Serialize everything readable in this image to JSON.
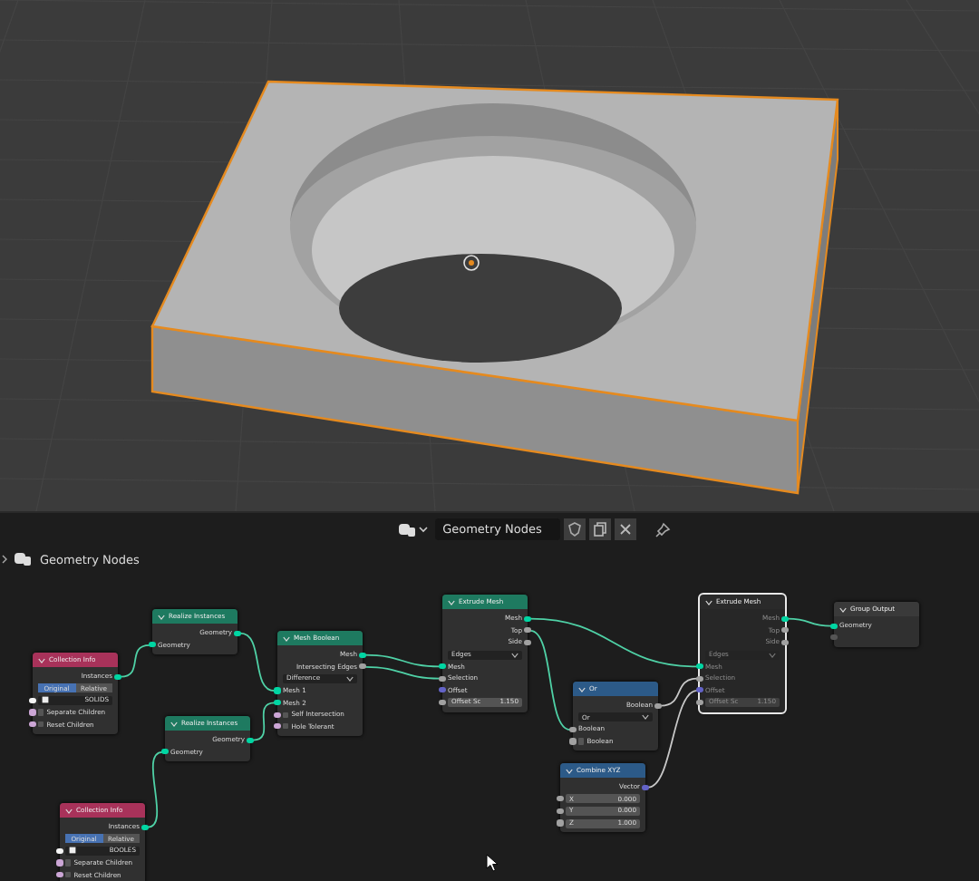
{
  "header": {
    "node_tree_name": "Geometry Nodes"
  },
  "breadcrumb": {
    "label": "Geometry Nodes"
  },
  "nodes": [
    {
      "title": "Collection Info",
      "color": "#a8325a",
      "selected": false,
      "muted": false,
      "rows": [
        {
          "kind": "output",
          "label": "Instances",
          "socket": {
            "color": "#00d6a3"
          }
        },
        {
          "kind": "toggle",
          "options": [
            {
              "label": "Original",
              "selected": true
            },
            {
              "label": "Relative",
              "selected": false
            }
          ]
        },
        {
          "kind": "field",
          "label": "SOLIDS",
          "socket": {
            "color": "#f5f5f5"
          }
        },
        {
          "kind": "checkbox",
          "label": "Separate Children",
          "checked": false,
          "socket": {
            "color": "#cca6d6"
          }
        },
        {
          "kind": "checkbox",
          "label": "Reset Children",
          "checked": false,
          "socket": {
            "color": "#cca6d6"
          }
        }
      ]
    },
    {
      "title": "Realize Instances",
      "color": "#1e7a60",
      "selected": false,
      "muted": false,
      "rows": [
        {
          "kind": "output",
          "label": "Geometry",
          "socket": {
            "color": "#00d6a3"
          }
        },
        {
          "kind": "input",
          "label": "Geometry",
          "socket": {
            "color": "#00d6a3"
          }
        }
      ]
    },
    {
      "title": "Realize Instances",
      "color": "#1e7a60",
      "selected": false,
      "muted": false,
      "rows": [
        {
          "kind": "output",
          "label": "Geometry",
          "socket": {
            "color": "#00d6a3"
          }
        },
        {
          "kind": "input",
          "label": "Geometry",
          "socket": {
            "color": "#00d6a3"
          }
        }
      ]
    },
    {
      "title": "Mesh Boolean",
      "color": "#1e7a60",
      "selected": false,
      "muted": false,
      "rows": [
        {
          "kind": "output",
          "label": "Mesh",
          "socket": {
            "color": "#00d6a3"
          }
        },
        {
          "kind": "output",
          "label": "Intersecting Edges",
          "socket": {
            "color": "#a1a1a1"
          }
        },
        {
          "kind": "enum",
          "label": "Difference"
        },
        {
          "kind": "input",
          "label": "Mesh 1",
          "socket": {
            "color": "#00d6a3"
          }
        },
        {
          "kind": "input",
          "label": "Mesh 2",
          "socket": {
            "color": "#00d6a3"
          }
        },
        {
          "kind": "checkbox",
          "label": "Self Intersection",
          "checked": false,
          "socket": {
            "color": "#cca6d6"
          }
        },
        {
          "kind": "checkbox",
          "label": "Hole Tolerant",
          "checked": false,
          "socket": {
            "color": "#cca6d6"
          }
        }
      ]
    },
    {
      "title": "Extrude Mesh",
      "color": "#1e7a60",
      "selected": false,
      "muted": false,
      "rows": [
        {
          "kind": "output",
          "label": "Mesh",
          "socket": {
            "color": "#00d6a3"
          }
        },
        {
          "kind": "output",
          "label": "Top",
          "socket": {
            "color": "#a1a1a1"
          }
        },
        {
          "kind": "output",
          "label": "Side",
          "socket": {
            "color": "#a1a1a1"
          }
        },
        {
          "kind": "enum",
          "label": "Edges"
        },
        {
          "kind": "input",
          "label": "Mesh",
          "socket": {
            "color": "#00d6a3"
          }
        },
        {
          "kind": "input",
          "label": "Selection",
          "socket": {
            "color": "#a1a1a1"
          }
        },
        {
          "kind": "input",
          "label": "Offset",
          "socket": {
            "color": "#6363c7"
          }
        },
        {
          "kind": "value",
          "label": "Offset Sc",
          "value": "1.150",
          "socket": {
            "color": "#a1a1a1"
          }
        }
      ]
    },
    {
      "title": "Or",
      "color": "#2c5a88",
      "selected": false,
      "muted": false,
      "rows": [
        {
          "kind": "output",
          "label": "Boolean",
          "socket": {
            "color": "#a1a1a1"
          }
        },
        {
          "kind": "enum",
          "label": "Or"
        },
        {
          "kind": "input",
          "label": "Boolean",
          "socket": {
            "color": "#a1a1a1"
          }
        },
        {
          "kind": "checkbox",
          "label": "Boolean",
          "checked": false,
          "socket": {
            "color": "#a1a1a1"
          }
        }
      ]
    },
    {
      "title": "Combine XYZ",
      "color": "#2c5a88",
      "selected": false,
      "muted": false,
      "rows": [
        {
          "kind": "output",
          "label": "Vector",
          "socket": {
            "color": "#6363c7"
          }
        },
        {
          "kind": "value",
          "label": "X",
          "value": "0.000",
          "socket": {
            "color": "#a1a1a1"
          }
        },
        {
          "kind": "value",
          "label": "Y",
          "value": "0.000",
          "socket": {
            "color": "#a1a1a1"
          }
        },
        {
          "kind": "value",
          "label": "Z",
          "value": "1.000",
          "socket": {
            "color": "#a1a1a1"
          }
        }
      ]
    },
    {
      "title": "Extrude Mesh",
      "color": "#2a2a2a",
      "selected": true,
      "muted": true,
      "rows": [
        {
          "kind": "output",
          "label": "Mesh",
          "socket": {
            "color": "#00d6a3"
          }
        },
        {
          "kind": "output",
          "label": "Top",
          "socket": {
            "color": "#a1a1a1"
          }
        },
        {
          "kind": "output",
          "label": "Side",
          "socket": {
            "color": "#a1a1a1"
          }
        },
        {
          "kind": "enum",
          "label": "Edges"
        },
        {
          "kind": "input",
          "label": "Mesh",
          "socket": {
            "color": "#00d6a3"
          }
        },
        {
          "kind": "input",
          "label": "Selection",
          "socket": {
            "color": "#a1a1a1"
          }
        },
        {
          "kind": "input",
          "label": "Offset",
          "socket": {
            "color": "#6363c7"
          }
        },
        {
          "kind": "value",
          "label": "Offset Sc",
          "value": "1.150",
          "socket": {
            "color": "#a1a1a1"
          }
        }
      ]
    },
    {
      "title": "Group Output",
      "color": "#3a3a3a",
      "selected": false,
      "muted": false,
      "rows": [
        {
          "kind": "input",
          "label": "Geometry",
          "socket": {
            "color": "#00d6a3"
          }
        },
        {
          "kind": "input",
          "socket": {
            "color": "#555555"
          }
        }
      ]
    },
    {
      "title": "Collection Info",
      "color": "#a8325a",
      "selected": false,
      "muted": false,
      "rows": [
        {
          "kind": "output",
          "label": "Instances",
          "socket": {
            "color": "#00d6a3"
          }
        },
        {
          "kind": "toggle",
          "options": [
            {
              "label": "Original",
              "selected": true
            },
            {
              "label": "Relative",
              "selected": false
            }
          ]
        },
        {
          "kind": "field",
          "label": "BOOLES",
          "socket": {
            "color": "#f5f5f5"
          }
        },
        {
          "kind": "checkbox",
          "label": "Separate Children",
          "checked": false,
          "socket": {
            "color": "#cca6d6"
          }
        },
        {
          "kind": "checkbox",
          "label": "Reset Children",
          "checked": false,
          "socket": {
            "color": "#cca6d6"
          }
        }
      ]
    }
  ]
}
